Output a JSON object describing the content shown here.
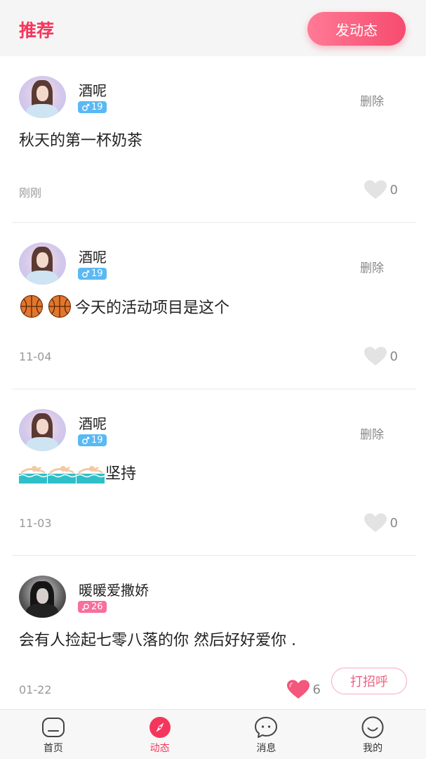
{
  "header": {
    "title": "推荐",
    "post_button": "发动态"
  },
  "colors": {
    "accent": "#f5365c",
    "male_badge": "#5ab9f3",
    "female_badge": "#f76f9a",
    "liked_heart": "#f4567c",
    "unliked_heart": "#e3e3e3"
  },
  "posts": [
    {
      "username": "酒呢",
      "gender": "male",
      "age": "19",
      "delete_label": "删除",
      "emojis": [],
      "text": "秋天的第一杯奶茶",
      "time": "刚刚",
      "likes": "0",
      "liked": false
    },
    {
      "username": "酒呢",
      "gender": "male",
      "age": "19",
      "delete_label": "删除",
      "emojis": [
        "basketball-icon",
        "basketball-icon"
      ],
      "text": "今天的活动项目是这个",
      "time": "11-04",
      "likes": "0",
      "liked": false
    },
    {
      "username": "酒呢",
      "gender": "male",
      "age": "19",
      "delete_label": "删除",
      "emojis": [
        "swimmer-icon",
        "swimmer-icon",
        "swimmer-icon"
      ],
      "text": "坚持",
      "time": "11-03",
      "likes": "0",
      "liked": false
    },
    {
      "username": "暖暖爱撒娇",
      "gender": "female",
      "age": "26",
      "emojis": [],
      "text": "会有人捡起七零八落的你 然后好好爱你 .",
      "time": "01-22",
      "likes": "6",
      "liked": true,
      "greet_label": "打招呼"
    }
  ],
  "tabbar": {
    "items": [
      {
        "label": "首页",
        "icon": "home-icon",
        "active": false
      },
      {
        "label": "动态",
        "icon": "compass-icon",
        "active": true
      },
      {
        "label": "消息",
        "icon": "chat-bubble-icon",
        "active": false
      },
      {
        "label": "我的",
        "icon": "smiley-face-icon",
        "active": false
      }
    ]
  }
}
